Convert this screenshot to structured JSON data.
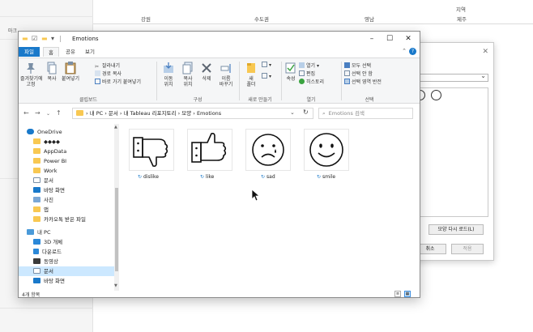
{
  "background": {
    "mark_label": "마크",
    "header_top": "지역",
    "regions": [
      "강원",
      "수도권",
      "영남",
      "제주"
    ]
  },
  "bg_dialog": {
    "reload_button": "모양 다시 로드(L)",
    "cancel_button": "취소",
    "apply_button": "적용"
  },
  "explorer": {
    "title": "Emotions",
    "ribbon_tabs": [
      "파일",
      "홈",
      "공유",
      "보기"
    ],
    "clipboard": {
      "pin": "즐겨찾기에\n고정",
      "copy": "복사",
      "paste": "붙여넣기",
      "cut": "잘라내기",
      "copy_path": "경로 복사",
      "paste_shortcut": "바로 가기 붙여넣기",
      "group": "클립보드"
    },
    "organize": {
      "move": "이동\n위치",
      "copyto": "복사\n위치",
      "delete": "삭제",
      "rename": "이름\n바꾸기",
      "group": "구성"
    },
    "new": {
      "folder": "새\n폴더",
      "group": "새로 만들기"
    },
    "open": {
      "properties": "속성",
      "open": "열기",
      "edit": "편집",
      "history": "히스토리",
      "group": "열기"
    },
    "select": {
      "all": "모두 선택",
      "none": "선택 안 함",
      "invert": "선택 영역 반전",
      "group": "선택"
    },
    "address": "› 내 PC › 문서 › 내 Tableau 리포지토리 › 모양 › Emotions",
    "search_placeholder": "Emotions 검색",
    "nav_items": [
      "OneDrive",
      "◆◆◆◆",
      "AppData",
      "Power BI",
      "Work",
      "문서",
      "바탕 화면",
      "사진",
      "앱",
      "카카오톡 받은 파일",
      "내 PC",
      "3D 개체",
      "다운로드",
      "동영상",
      "문서",
      "바탕 화면"
    ],
    "files": [
      "dislike",
      "like",
      "sad",
      "smile"
    ],
    "status": "4개 항목"
  }
}
